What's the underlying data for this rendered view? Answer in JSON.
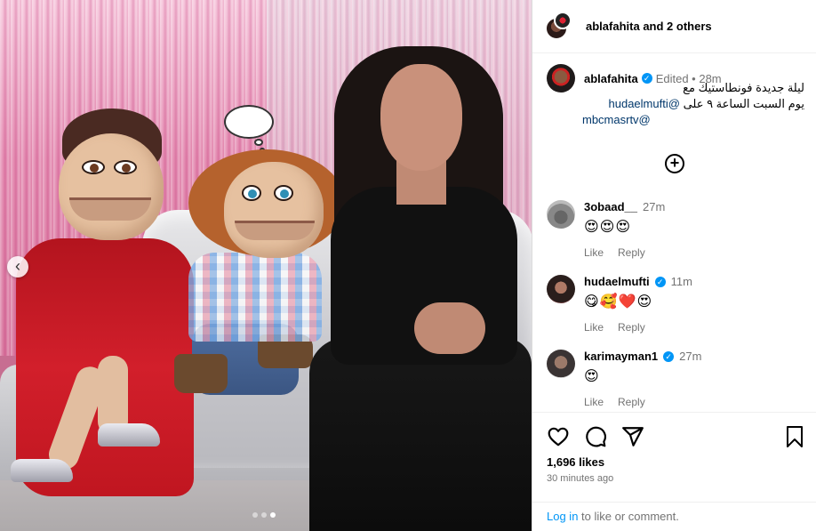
{
  "header": {
    "username": "ablafahita",
    "others_text": "and 2 others"
  },
  "caption": {
    "username": "ablafahita",
    "edited": "Edited",
    "age": "28m",
    "line1": "ليلة جديدة فونطاستيك مع",
    "line2_text": "يوم السبت الساعة ٩ على",
    "line2_mention": "@hudaelmufti",
    "line3_mention": "mbcmasrtv@"
  },
  "comments": [
    {
      "user": "3obaad__",
      "age": "27m",
      "verified": false,
      "text": "😍😍😍",
      "like": "Like",
      "reply": "Reply"
    },
    {
      "user": "hudaelmufti",
      "age": "11m",
      "verified": true,
      "text": "😋🥰❤️😍",
      "like": "Like",
      "reply": "Reply"
    },
    {
      "user": "karimayman1",
      "age": "27m",
      "verified": true,
      "text": "😍",
      "like": "Like",
      "reply": "Reply"
    }
  ],
  "stats": {
    "likes": "1,696 likes",
    "time": "30 minutes ago"
  },
  "login": {
    "link": "Log in",
    "rest": " to like or comment."
  },
  "carousel": {
    "total": 3,
    "active": 3,
    "prev_arrow": "‹"
  },
  "colors": {
    "link": "#0095f6",
    "mention": "#00376b",
    "verified": "#0095f6"
  }
}
